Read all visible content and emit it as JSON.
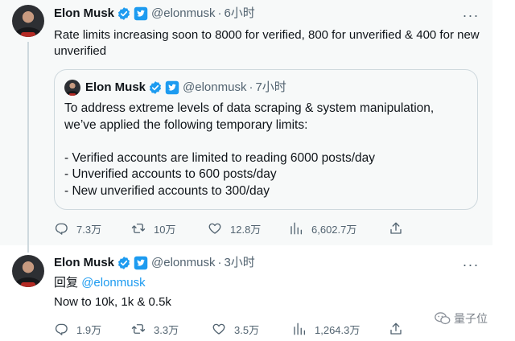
{
  "tweet1": {
    "author_name": "Elon Musk",
    "handle": "@elonmusk",
    "dot": "·",
    "time": "6小时",
    "text": "Rate limits increasing soon to 8000 for verified, 800 for unverified & 400 for new unverified",
    "quote": {
      "author_name": "Elon Musk",
      "handle": "@elonmusk",
      "dot": "·",
      "time": "7小时",
      "text": "To address extreme levels of data scraping & system manipulation, we’ve applied the following temporary limits:\n\n- Verified accounts are limited to reading 6000 posts/day\n- Unverified accounts to 600 posts/day\n- New unverified accounts to 300/day"
    },
    "actions": {
      "replies": "7.3万",
      "retweets": "10万",
      "likes": "12.8万",
      "views": "6,602.7万"
    }
  },
  "tweet2": {
    "author_name": "Elon Musk",
    "handle": "@elonmusk",
    "dot": "·",
    "time": "3小时",
    "reply_prefix": "回复",
    "reply_to": "@elonmusk",
    "text": "Now to 10k, 1k & 0.5k",
    "actions": {
      "replies": "1.9万",
      "retweets": "3.3万",
      "likes": "3.5万",
      "views": "1,264.3万"
    }
  },
  "watermark": {
    "text": "量子位"
  },
  "icons": {
    "verified": "verified-badge-icon",
    "brand": "twitter-blue-square-icon",
    "more": "more-dots-icon",
    "reply": "reply-icon",
    "retweet": "retweet-icon",
    "like": "heart-icon",
    "views": "views-chart-icon",
    "share": "share-icon"
  },
  "colors": {
    "accent": "#1d9bf0",
    "muted_text": "#536471",
    "text": "#0f1419",
    "tweet_bg": "#f7f9f9",
    "border": "#cfd9de"
  }
}
